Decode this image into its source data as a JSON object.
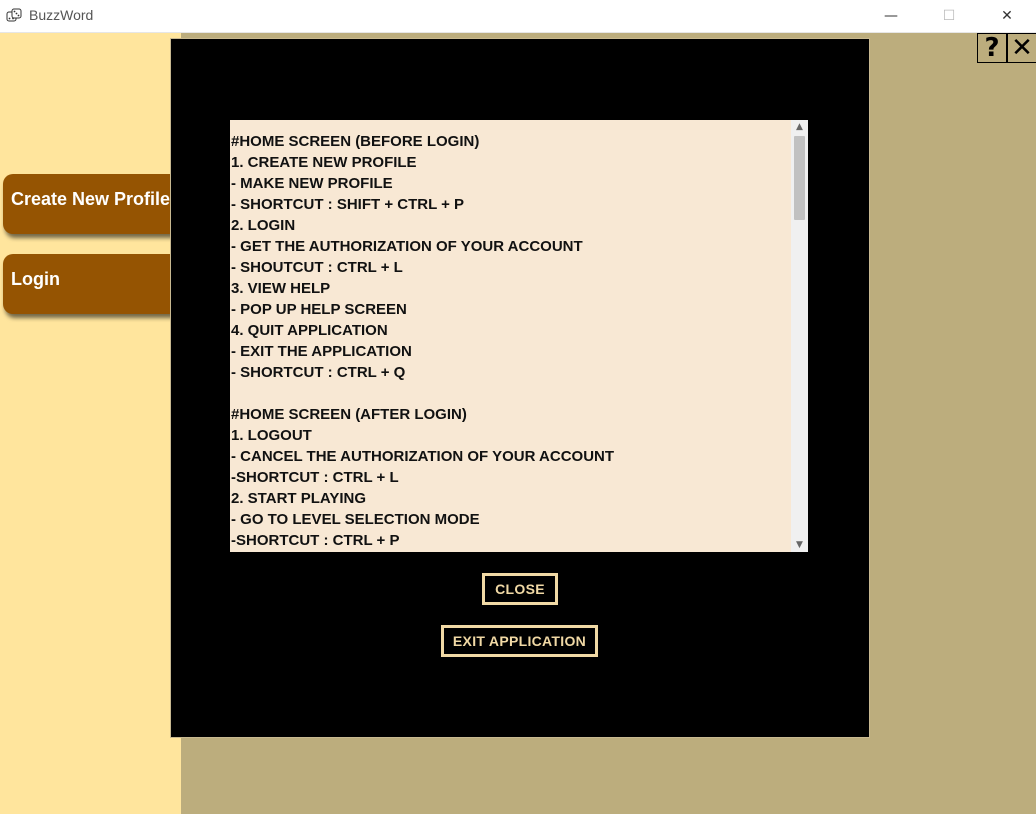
{
  "window": {
    "title": "BuzzWord",
    "app_icon": "dice-icon",
    "min_glyph": "—",
    "max_glyph": "☐",
    "close_glyph": "✕"
  },
  "sidebar": {
    "items": [
      {
        "label": "Create New Profile"
      },
      {
        "label": "Login"
      }
    ]
  },
  "toolbar": {
    "help_glyph": "?",
    "close_glyph": "✕"
  },
  "help_dialog": {
    "lines": [
      "#HOME SCREEN (BEFORE LOGIN)",
      "1. CREATE NEW PROFILE",
      "- MAKE NEW PROFILE",
      "- SHORTCUT : SHIFT + CTRL + P",
      "2. LOGIN",
      "- GET THE AUTHORIZATION OF YOUR ACCOUNT",
      "- SHOUTCUT : CTRL + L",
      "3. VIEW HELP",
      "- POP UP HELP SCREEN",
      "4. QUIT APPLICATION",
      "- EXIT THE APPLICATION",
      "- SHORTCUT : CTRL + Q",
      "",
      "#HOME SCREEN (AFTER LOGIN)",
      "1. LOGOUT",
      "- CANCEL THE AUTHORIZATION OF YOUR ACCOUNT",
      "-SHORTCUT : CTRL + L",
      "2. START PLAYING",
      "- GO TO LEVEL SELECTION MODE",
      "-SHORTCUT : CTRL + P"
    ],
    "close_label": "CLOSE",
    "exit_label": "EXIT APPLICATION",
    "scroll_up_glyph": "▲",
    "scroll_down_glyph": "▼"
  },
  "colors": {
    "sidebar_bg": "#ffe59d",
    "main_bg": "#bcad7d",
    "button_brown": "#955402",
    "help_bg": "#f8e8d4",
    "dialog_button_border": "#f1d9a5"
  }
}
